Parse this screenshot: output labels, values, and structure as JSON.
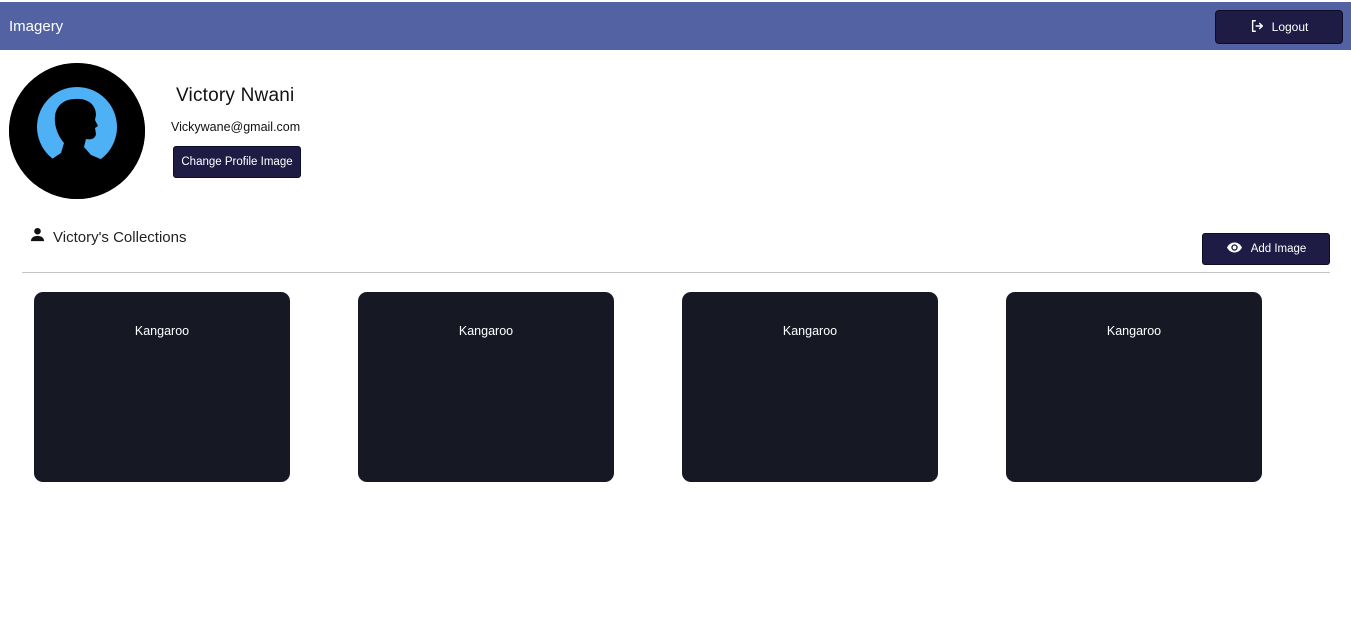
{
  "header": {
    "brand": "Imagery",
    "logout_label": "Logout",
    "logout_icon": "logout-icon"
  },
  "profile": {
    "name": "Victory Nwani",
    "email": "Vickywane@gmail.com",
    "change_image_label": "Change Profile Image",
    "avatar_icon": "user-silhouette-avatar"
  },
  "collections": {
    "title": "Victory's Collections",
    "title_icon": "person-icon",
    "add_image_label": "Add Image",
    "add_image_icon": "eye-icon",
    "items": [
      {
        "title": "Kangaroo"
      },
      {
        "title": "Kangaroo"
      },
      {
        "title": "Kangaroo"
      },
      {
        "title": "Kangaroo"
      }
    ]
  },
  "colors": {
    "header_bg": "#5262a2",
    "button_bg": "#1e1c45",
    "card_bg": "#161824",
    "avatar_ring": "#4eb0f5"
  }
}
